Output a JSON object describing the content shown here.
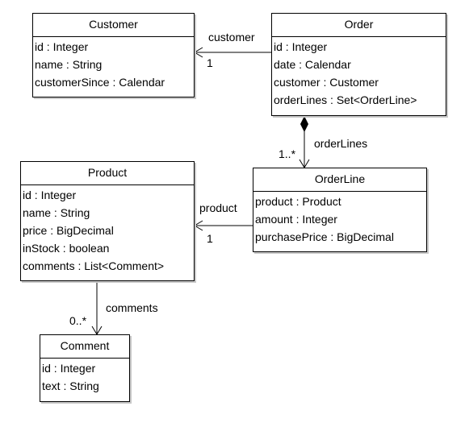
{
  "classes": {
    "customer": {
      "name": "Customer",
      "attributes": [
        "id : Integer",
        "name : String",
        "customerSince : Calendar"
      ]
    },
    "order": {
      "name": "Order",
      "attributes": [
        "id : Integer",
        "date : Calendar",
        "customer : Customer",
        "orderLines : Set<OrderLine>"
      ]
    },
    "product": {
      "name": "Product",
      "attributes": [
        "id : Integer",
        "name : String",
        "price : BigDecimal",
        "inStock : boolean",
        "comments : List<Comment>"
      ]
    },
    "orderline": {
      "name": "OrderLine",
      "attributes": [
        "product : Product",
        "amount : Integer",
        "purchasePrice : BigDecimal"
      ]
    },
    "comment": {
      "name": "Comment",
      "attributes": [
        "id : Integer",
        "text : String"
      ]
    }
  },
  "associations": {
    "order_customer": {
      "role": "customer",
      "multiplicity": "1",
      "type": "navigable"
    },
    "order_orderlines": {
      "role": "orderLines",
      "multiplicity": "1..*",
      "type": "composition"
    },
    "orderline_product": {
      "role": "product",
      "multiplicity": "1",
      "type": "navigable"
    },
    "product_comments": {
      "role": "comments",
      "multiplicity": "0..*",
      "type": "navigable"
    }
  }
}
